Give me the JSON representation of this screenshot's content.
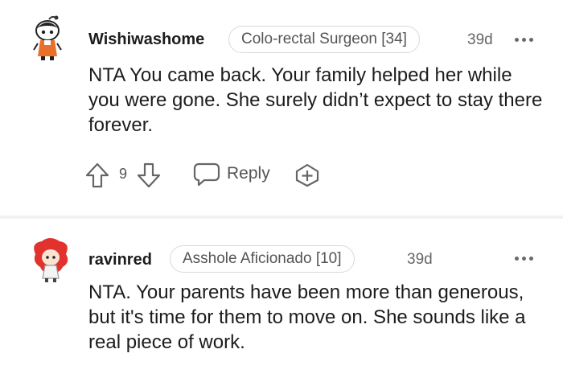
{
  "comments": [
    {
      "username": "Wishiwashome",
      "flair": "Colo-rectal Surgeon [34]",
      "time": "39d",
      "body": "NTA You came back. Your family helped her while you were gone. She surely didn’t expect to stay there forever.",
      "score": "9",
      "reply_label": "Reply"
    },
    {
      "username": "ravinred",
      "flair": "Asshole Aficionado [10]",
      "time": "39d",
      "body": "NTA. Your parents have been more than generous, but it's time for them to move on. She sounds like a real piece of work."
    }
  ],
  "icons": {
    "upvote": "arrow-up-outline-icon",
    "downvote": "arrow-down-outline-icon",
    "reply": "speech-bubble-icon",
    "award": "plus-badge-icon",
    "more": "three-dots-icon"
  }
}
